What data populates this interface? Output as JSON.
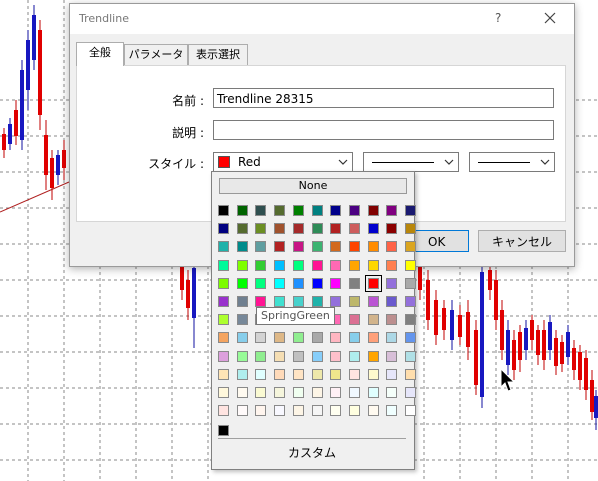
{
  "window": {
    "title": "Trendline"
  },
  "titlebar": {
    "help": "?",
    "close_icon": "close-icon"
  },
  "tabs": [
    {
      "label": "全般",
      "active": true
    },
    {
      "label": "パラメーター",
      "active": false
    },
    {
      "label": "表示選択",
      "active": false
    }
  ],
  "form": {
    "name_label": "名前 :",
    "name_value": "Trendline 28315",
    "desc_label": "説明 :",
    "desc_value": "",
    "style_label": "スタイル :",
    "color_value": "Red",
    "color_swatch": "#ff0000"
  },
  "buttons": {
    "ok": "OK",
    "cancel": "キャンセル"
  },
  "palette": {
    "none_label": "None",
    "custom_label": "カスタム",
    "tooltip": "SpringGreen",
    "selected": "Red",
    "rows": [
      [
        "#000000",
        "#006400",
        "#2f4f4f",
        "#556b2f",
        "#008000",
        "#008080",
        "#00008b",
        "#4b0082",
        "#800000",
        "#800080",
        "#191970"
      ],
      [
        "#000080",
        "#556b2f",
        "#6b8e23",
        "#a0522d",
        "#a52a2a",
        "#2e8b57",
        "#b22222",
        "#cd5c5c",
        "#0000cd",
        "#8b0000",
        "#b8860b"
      ],
      [
        "#20b2aa",
        "#008b8b",
        "#5f9ea0",
        "#b22222",
        "#c71585",
        "#3cb371",
        "#d2691e",
        "#ff4500",
        "#ff8c00",
        "#ff6347",
        "#daa520"
      ],
      [
        "#00fa9a",
        "#7fff00",
        "#32cd32",
        "#00bfff",
        "#00ff7f",
        "#ff1493",
        "#ff69b4",
        "#ffa500",
        "#ffd700",
        "#ff7f50",
        "#ffff00"
      ],
      [
        "#7cfc00",
        "#00ff00",
        "#00ff7f",
        "#00ffff",
        "#1e90ff",
        "#0000ff",
        "#ff00ff",
        "#808080",
        "#ff0000",
        "#9370db",
        "#a9a9a9"
      ],
      [
        "#9932cc",
        "#708090",
        "#ff1493",
        "#40e0d0",
        "#48d1cc",
        "#20b2aa",
        "#9370db",
        "#bdb76b",
        "#ba55d3",
        "#6a5acd",
        "#9370db"
      ],
      [
        "#adff2f",
        "#778899",
        "#9370db",
        "#c0c0c0",
        "#66cdaa",
        "#f4a460",
        "#ff69b4",
        "#db7093",
        "#d2b48c",
        "#bc8f8f",
        "#808080"
      ],
      [
        "#f4a460",
        "#87ceeb",
        "#d3d3d3",
        "#deb887",
        "#90ee90",
        "#a9a9a9",
        "#ffb6c1",
        "#87ceeb",
        "#ffa07a",
        "#add8e6",
        "#6495ed"
      ],
      [
        "#dda0dd",
        "#98fb98",
        "#90ee90",
        "#f5deb3",
        "#c0c0c0",
        "#87cefa",
        "#ffc0cb",
        "#afeeee",
        "#ffa500",
        "#d8bfd8",
        "#b0e0e6"
      ],
      [
        "#ffe4b5",
        "#afeeee",
        "#e0ffff",
        "#ffdab9",
        "#ffe4c4",
        "#eee8aa",
        "#f0e68c",
        "#ffe4e1",
        "#fffacd",
        "#e6e6fa",
        "#ffdead"
      ],
      [
        "#fff8dc",
        "#fffaf0",
        "#fafad2",
        "#f5f5dc",
        "#f0fff0",
        "#fdf5e6",
        "#fff0f5",
        "#f0f8ff",
        "#e0ffff",
        "#f5fffa",
        "#e6e6fa"
      ],
      [
        "#ffe4e1",
        "#fffafa",
        "#fff5ee",
        "#f8f8ff",
        "#fdf5e6",
        "#f5f5f5",
        "#fffff0",
        "#ffffe0",
        "#fffaf0",
        "#f0ffff",
        "#ffffff"
      ]
    ],
    "extra": [
      "#000000"
    ]
  }
}
